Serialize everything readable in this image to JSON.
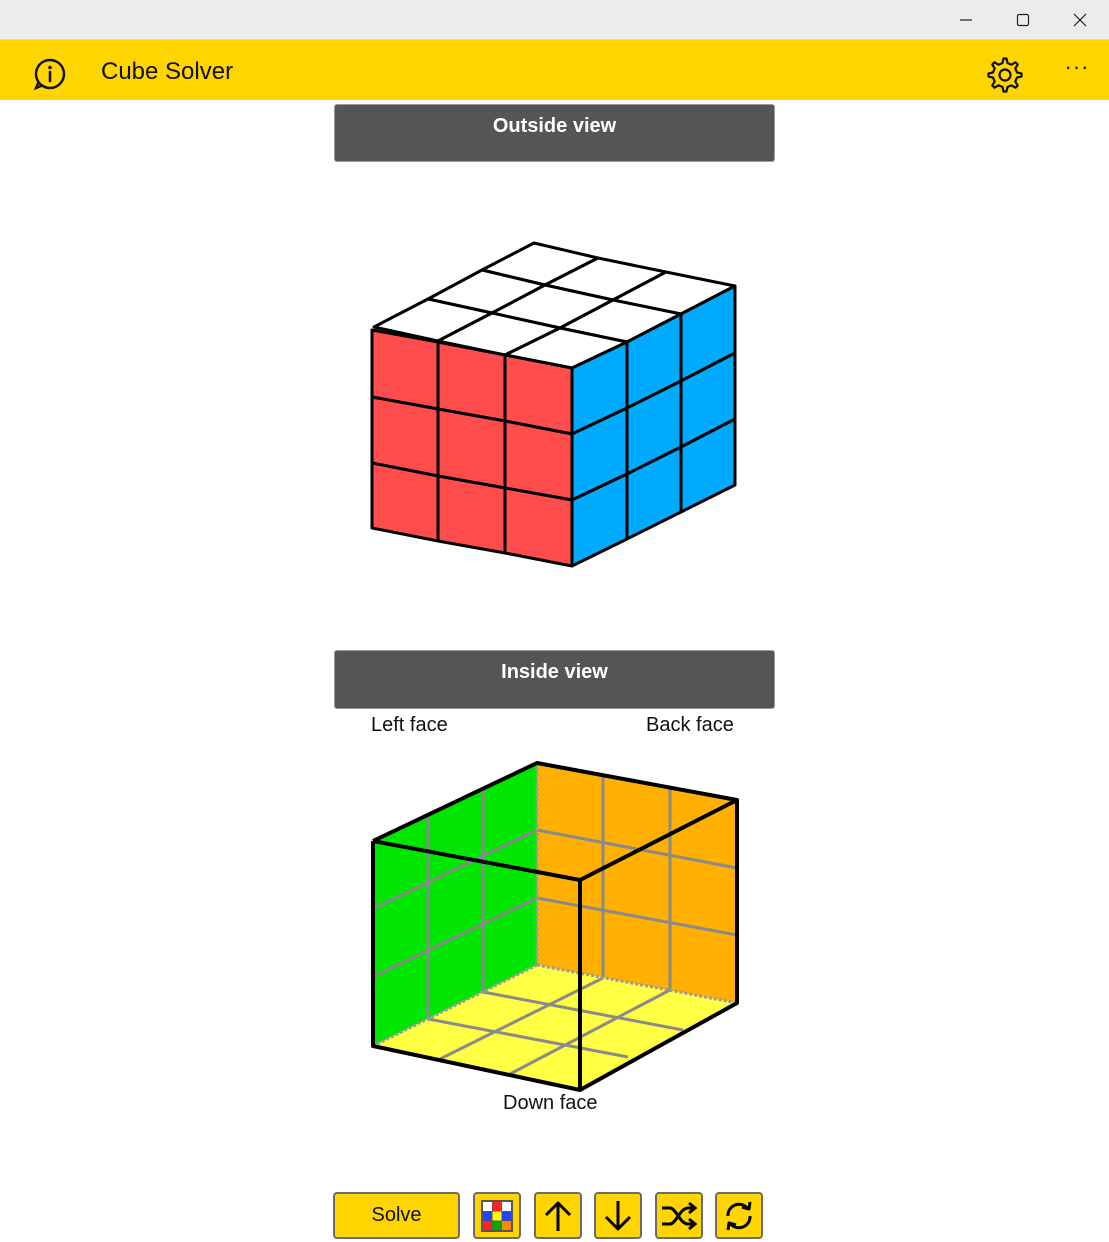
{
  "app": {
    "title": "Cube Solver"
  },
  "window_controls": {
    "minimize": "minimize-icon",
    "maximize": "maximize-icon",
    "close": "close-icon"
  },
  "appbar": {
    "info_icon": "info-icon",
    "settings_icon": "gear-icon",
    "more_label": "···"
  },
  "outside": {
    "header": "Outside view",
    "colors": {
      "top": "#ffffff",
      "front": "#ff4d4d",
      "right": "#00aaff"
    }
  },
  "inside": {
    "header": "Inside view",
    "left_label": "Left face",
    "back_label": "Back face",
    "down_label": "Down face",
    "colors": {
      "left": "#00e600",
      "back": "#ffb000",
      "down": "#ffff44"
    }
  },
  "toolbar": {
    "solve_label": "Solve",
    "buttons": [
      "color-palette-icon",
      "arrow-up-icon",
      "arrow-down-icon",
      "shuffle-icon",
      "refresh-icon"
    ]
  },
  "colors": {
    "accent": "#ffd500",
    "header_bg": "#555555"
  }
}
